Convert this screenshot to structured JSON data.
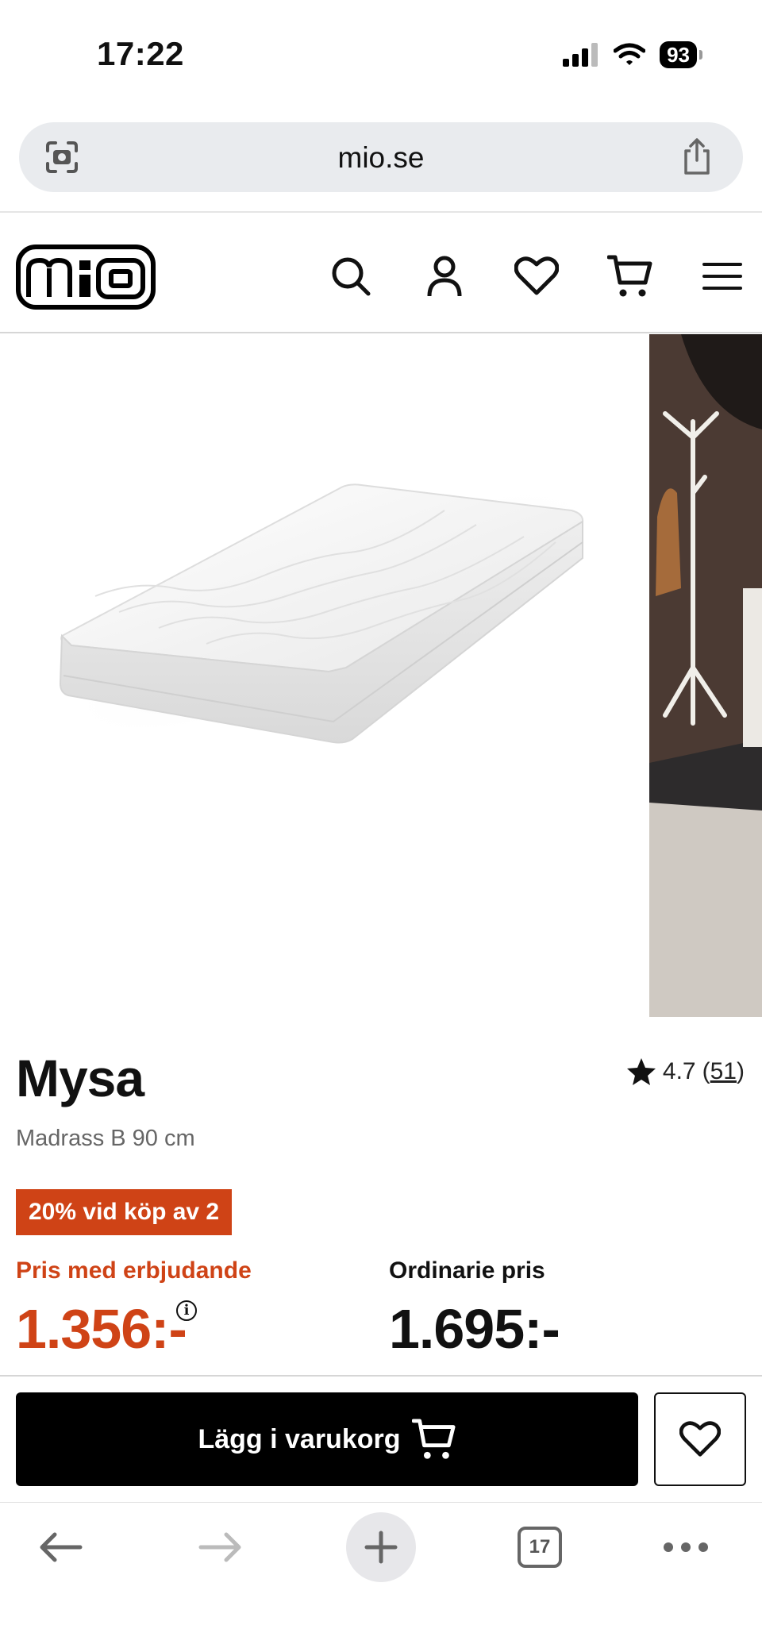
{
  "status_bar": {
    "time": "17:22",
    "battery": "93"
  },
  "browser": {
    "url": "mio.se",
    "tabs_count": "17"
  },
  "header": {
    "logo_alt": "mio"
  },
  "product": {
    "name": "Mysa",
    "subtitle": "Madrass B 90 cm",
    "rating": "4.7",
    "rating_count": "51",
    "promo_badge": "20% vid köp av 2",
    "offer_label": "Pris med erbjudande",
    "offer_price": "1.356:-",
    "regular_label": "Ordinarie pris",
    "regular_price": "1.695:-",
    "add_to_cart_label": "Lägg i varukorg"
  },
  "colors": {
    "accent": "#cf4316",
    "button": "#000000"
  }
}
